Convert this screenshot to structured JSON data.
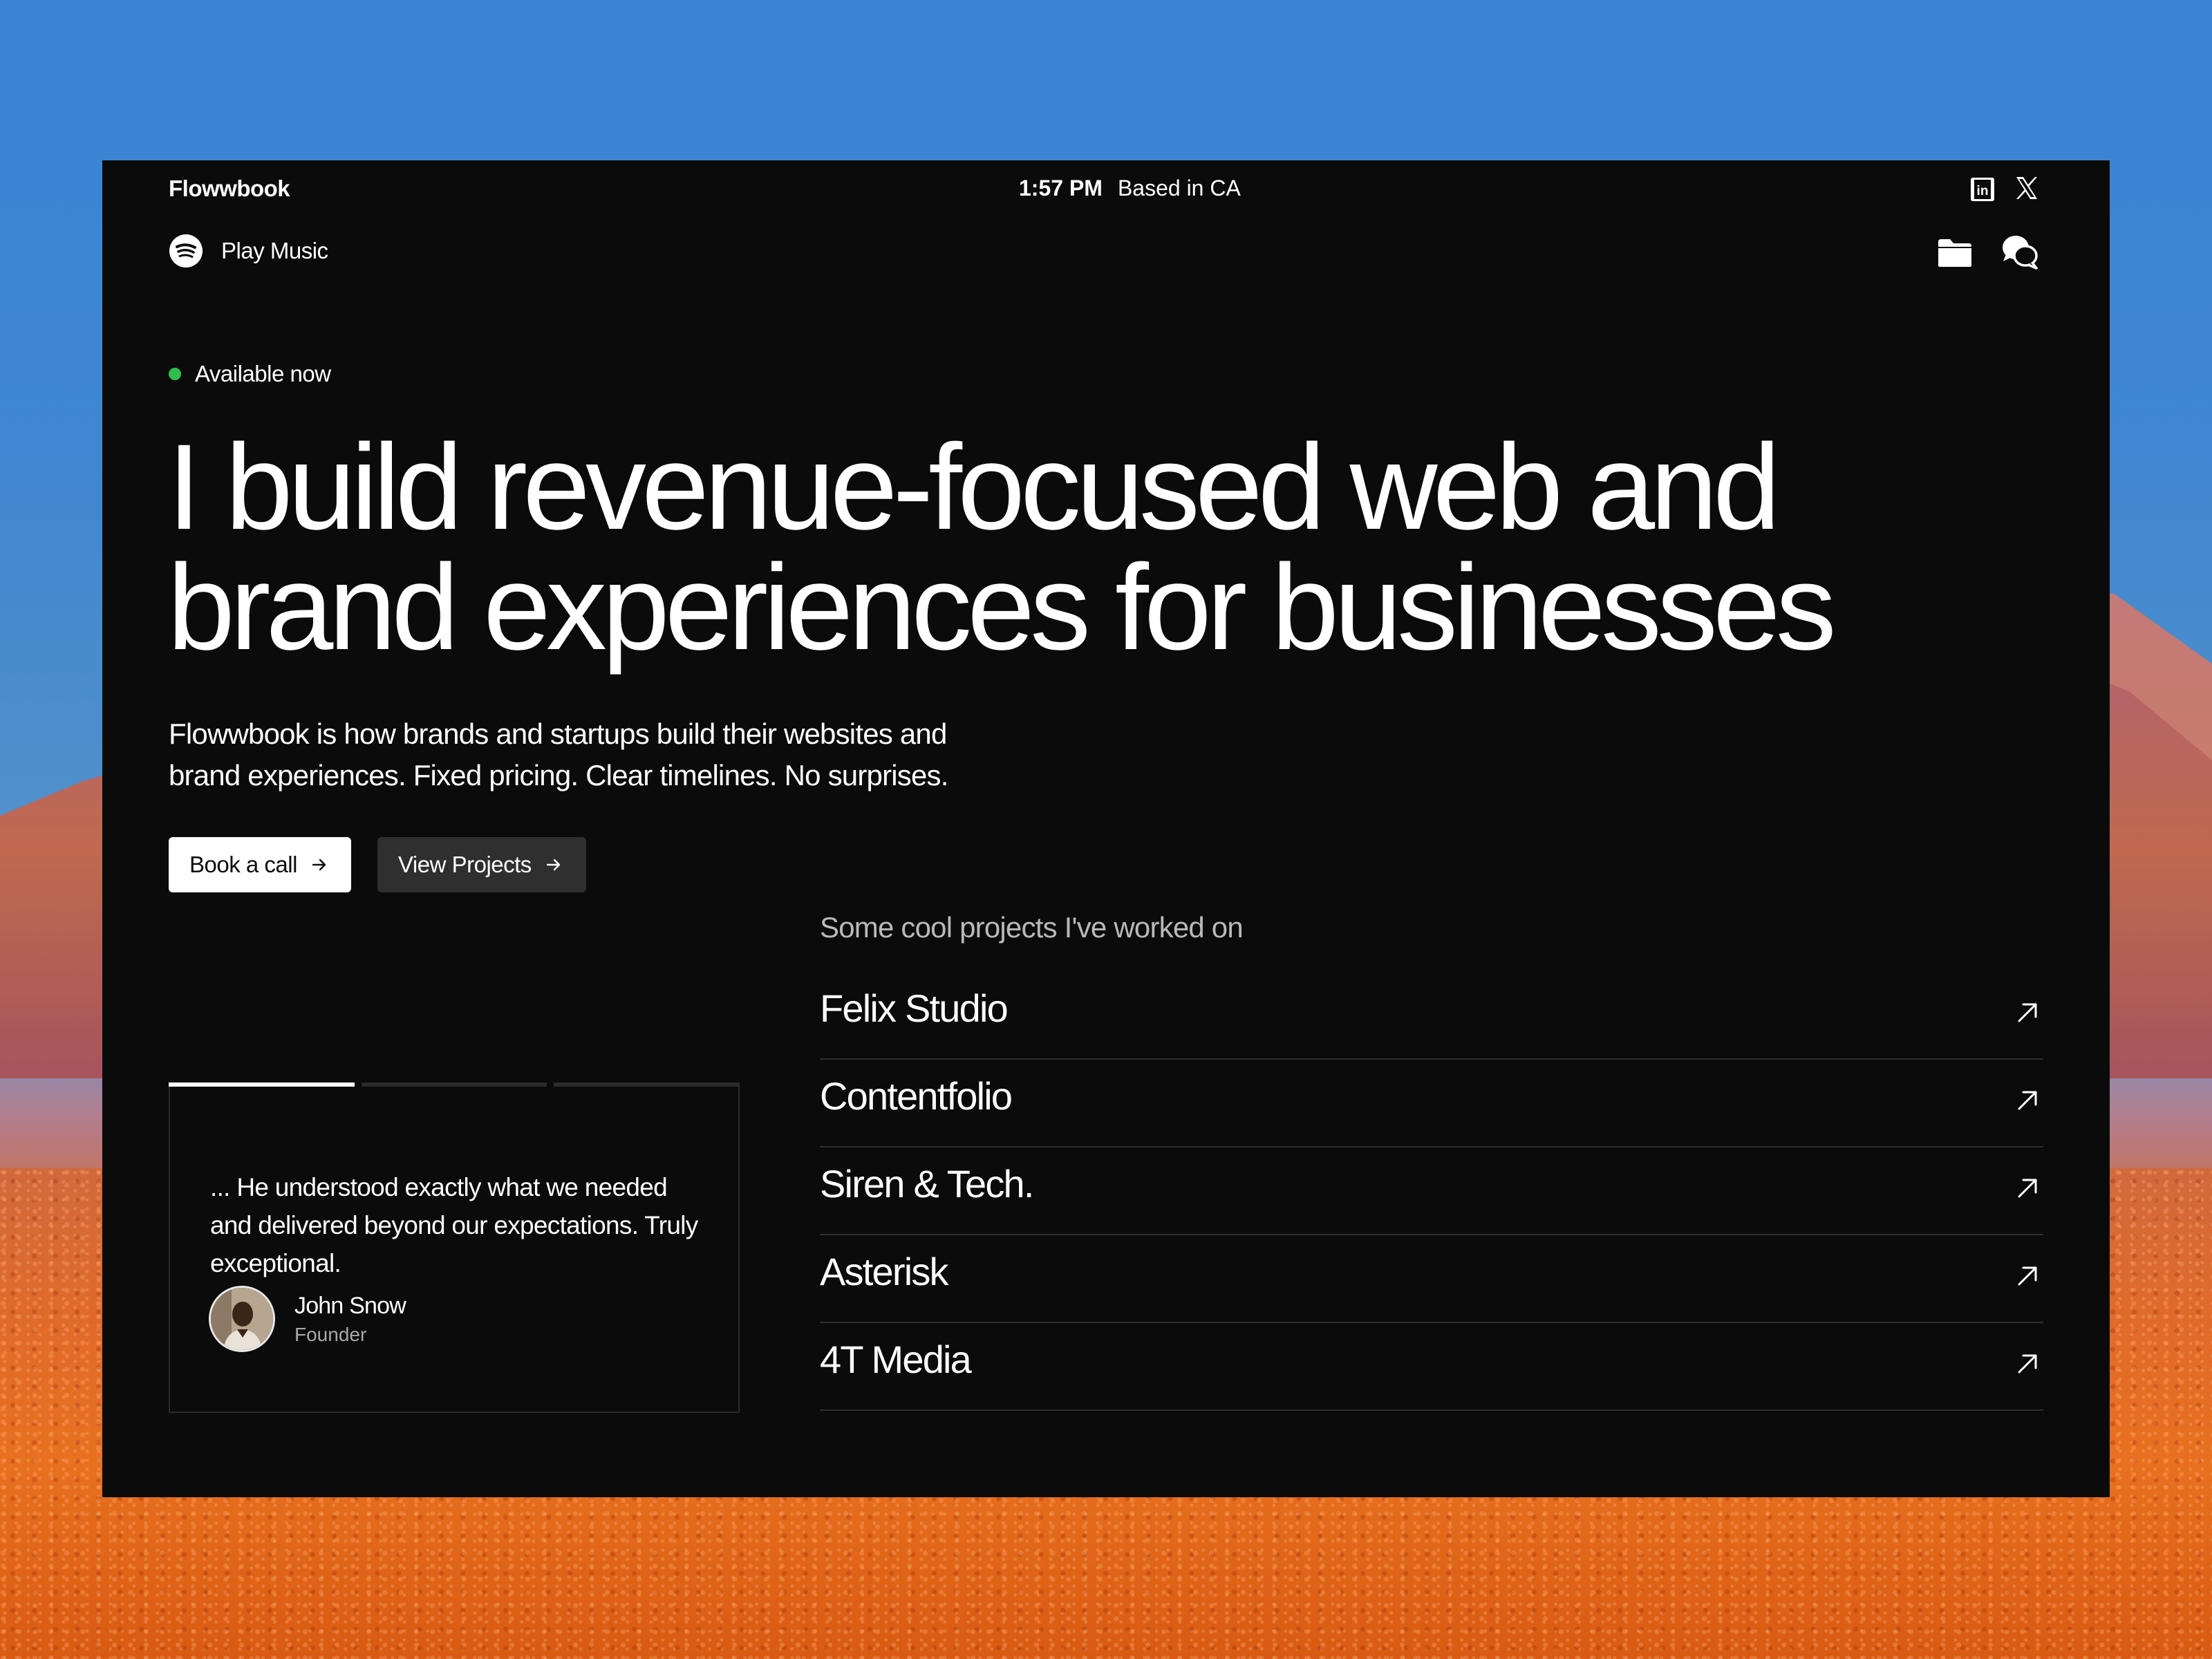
{
  "header": {
    "brand": "Flowwbook",
    "time": "1:57 PM",
    "location": "Based in CA",
    "social_icons": [
      "linkedin-icon",
      "x-icon"
    ],
    "music_label": "Play Music",
    "action_icons": [
      "folder-icon",
      "chat-icon"
    ]
  },
  "hero": {
    "availability": "Available now",
    "status_color": "#2fbf4f",
    "headline_line1": "I build revenue-focused web and",
    "headline_line2": "brand experiences for businesses",
    "sub_line1": "Flowwbook is how brands and startups build their websites and",
    "sub_line2": "brand experiences. Fixed pricing. Clear timelines. No surprises.",
    "cta_primary": "Book a call",
    "cta_secondary": "View Projects"
  },
  "projects": {
    "heading": "Some cool projects I've worked on",
    "items": [
      "Felix Studio",
      "Contentfolio",
      "Siren & Tech.",
      "Asterisk",
      "4T Media"
    ]
  },
  "testimonial": {
    "slides_total": 3,
    "active_slide": 1,
    "quote_line1": "... He understood exactly what we needed",
    "quote_line2": "and delivered beyond our expectations. Truly",
    "quote_line3": "exceptional.",
    "author": "John Snow",
    "role": "Founder"
  }
}
